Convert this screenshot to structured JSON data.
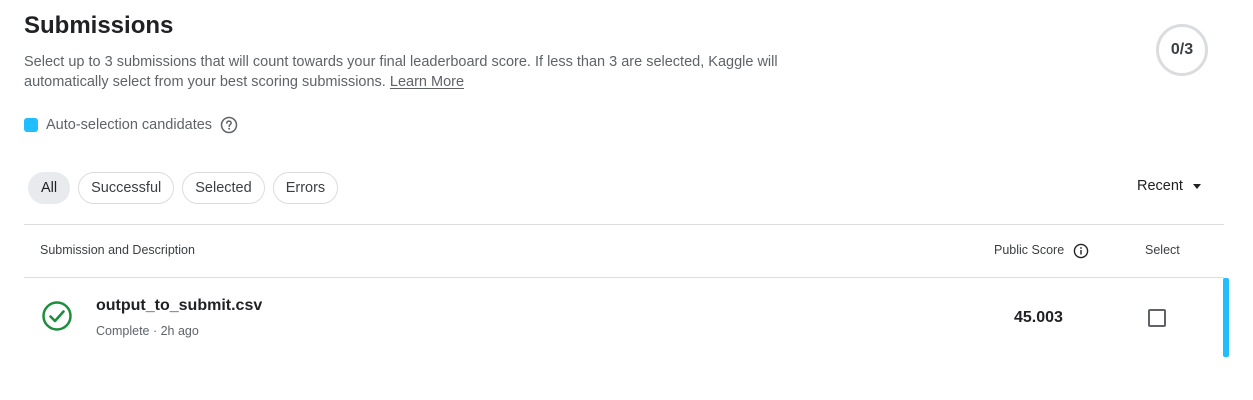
{
  "header": {
    "title": "Submissions",
    "description": "Select up to 3 submissions that will count towards your final leaderboard score. If less than 3 are selected, Kaggle will automatically select from your best scoring submissions.",
    "learn_more": "Learn More",
    "counter": "0/3"
  },
  "legend": {
    "label": "Auto-selection candidates",
    "swatch_color": "#20beff",
    "help_icon": "question-circle-icon"
  },
  "filters": {
    "tabs": [
      {
        "label": "All",
        "active": true
      },
      {
        "label": "Successful",
        "active": false
      },
      {
        "label": "Selected",
        "active": false
      },
      {
        "label": "Errors",
        "active": false
      }
    ],
    "sort_label": "Recent"
  },
  "table": {
    "col_submission": "Submission and Description",
    "col_score": "Public Score",
    "col_select": "Select",
    "rows": [
      {
        "file": "output_to_submit.csv",
        "status": "Complete",
        "time": "2h ago",
        "meta": "Complete · 2h ago",
        "score": "45.003",
        "selected": false,
        "status_icon": "check-circle-icon",
        "status_color": "#1e8e3e"
      }
    ]
  }
}
